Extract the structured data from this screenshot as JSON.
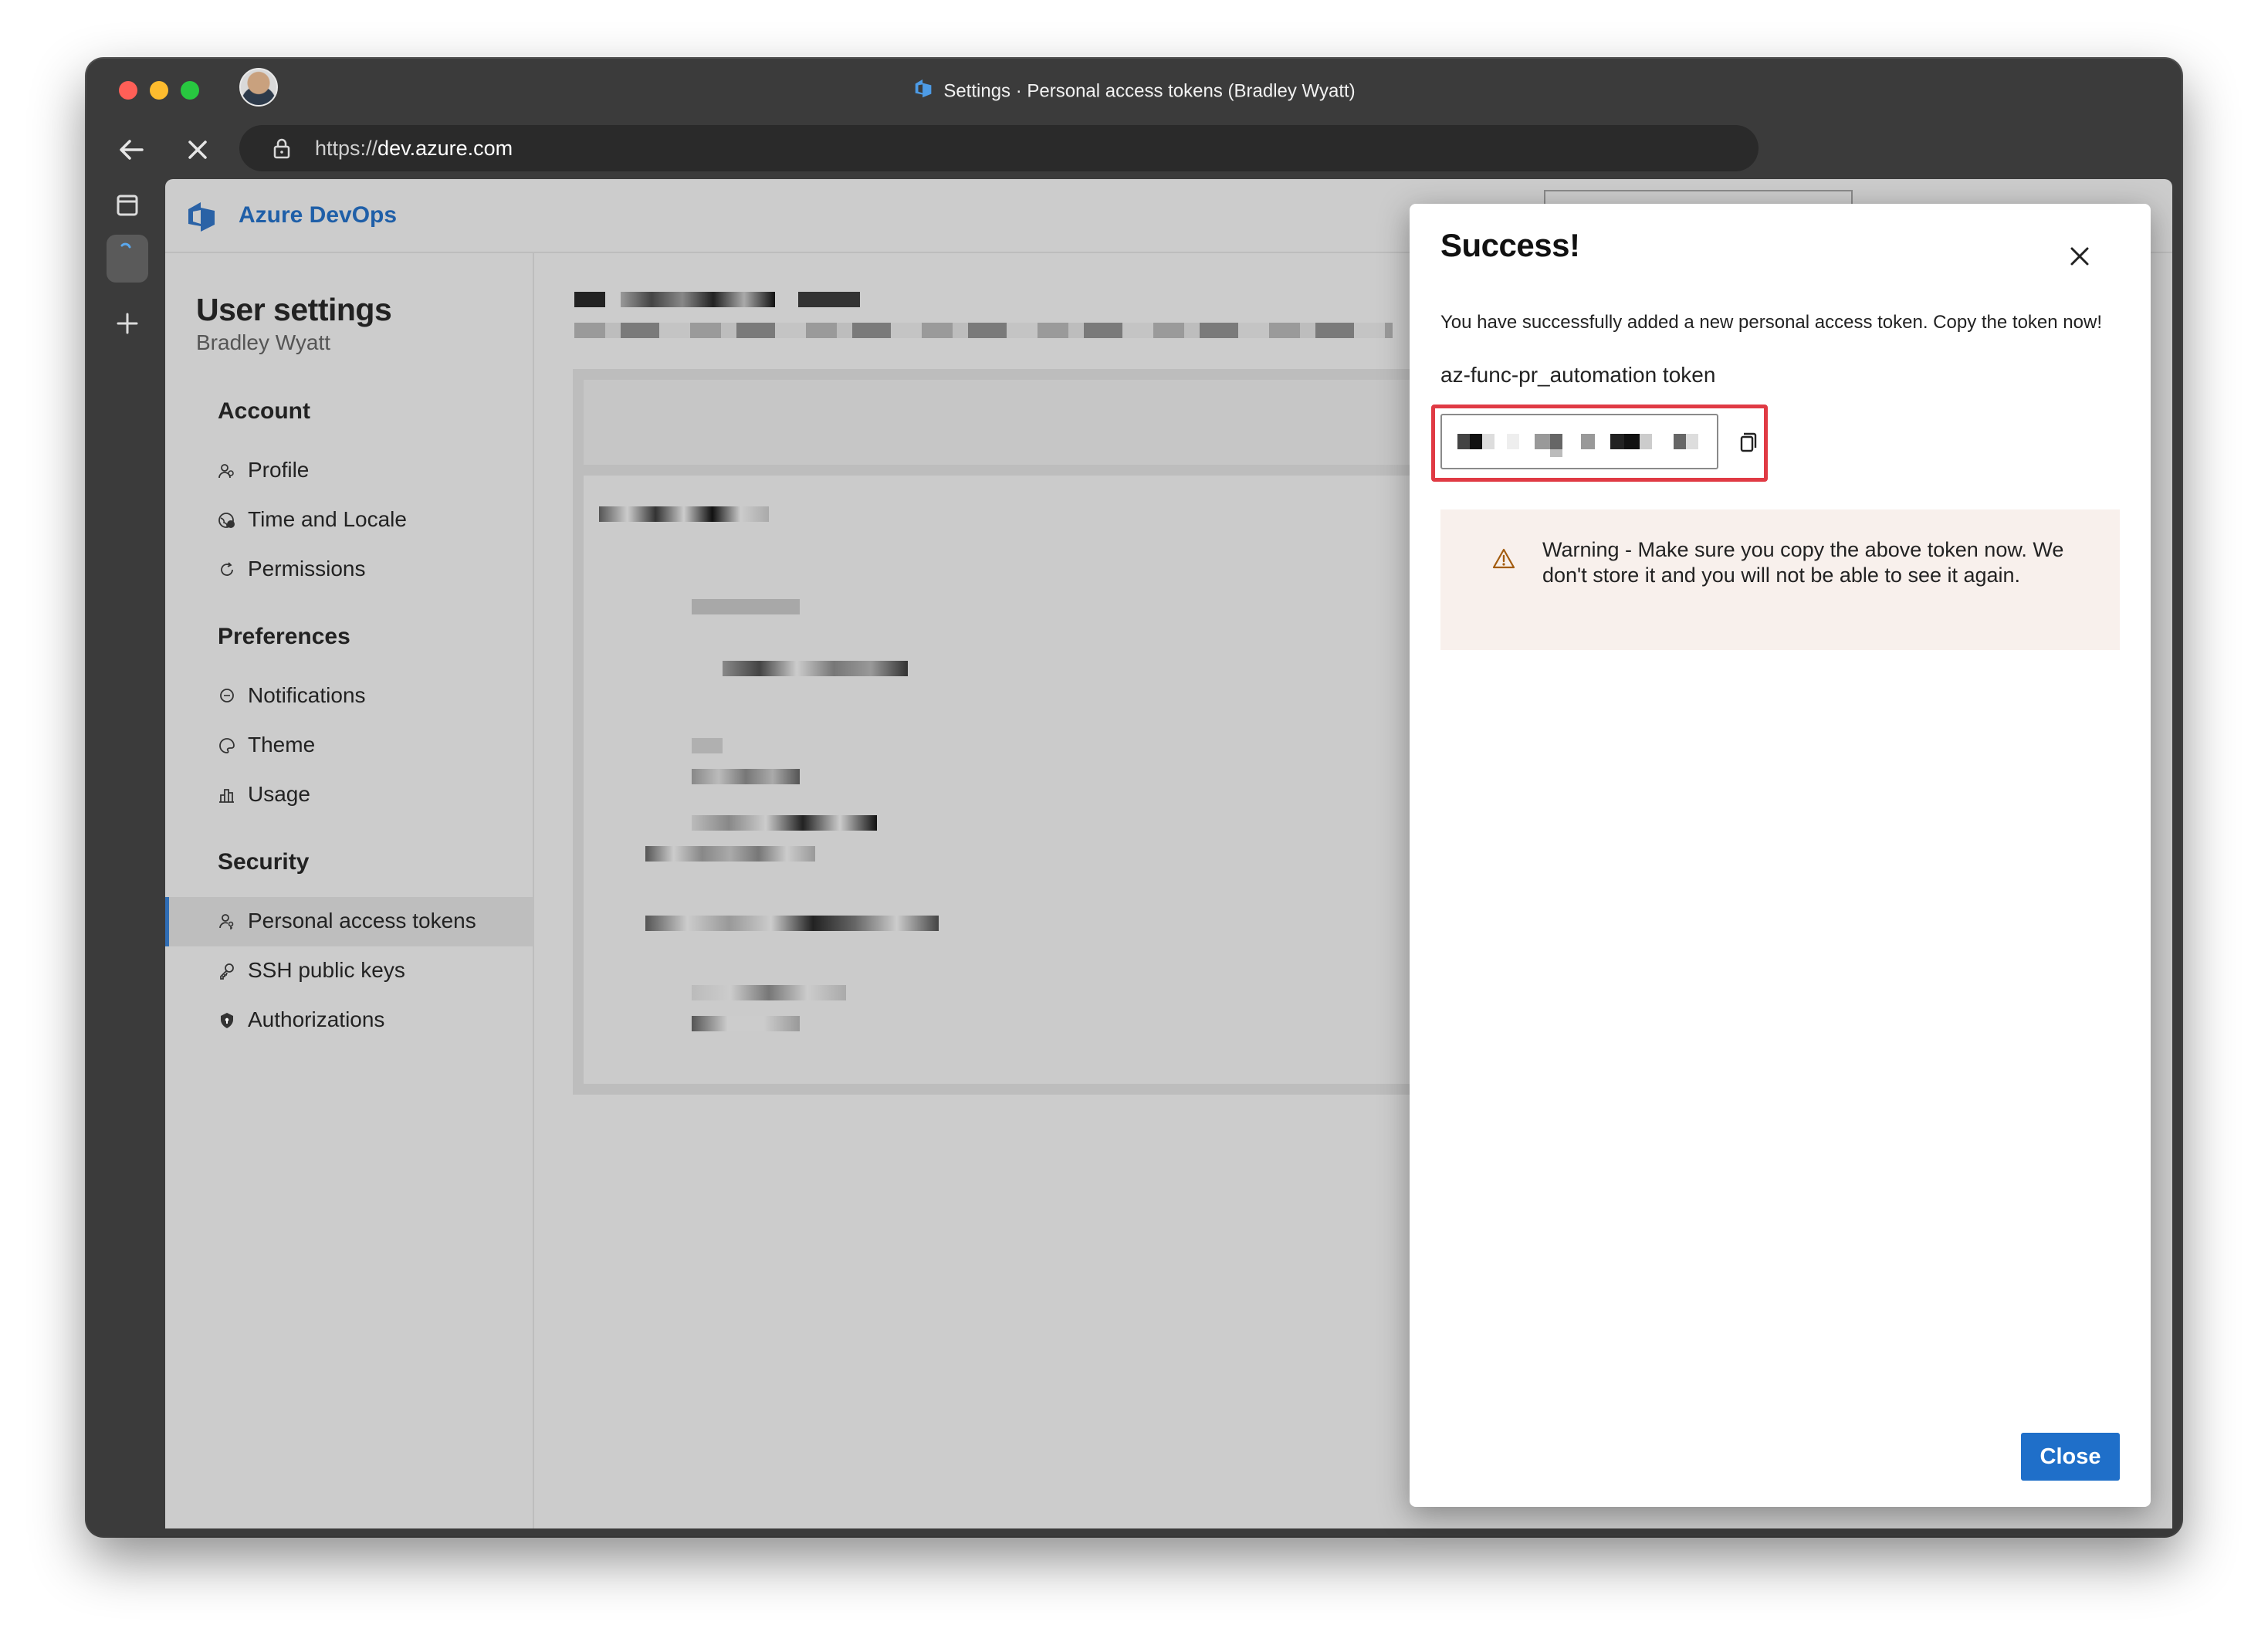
{
  "browser": {
    "window_title": "Settings · Personal access tokens (Bradley Wyatt)",
    "url_scheme": "https://",
    "url_host": "dev.azure.com"
  },
  "app": {
    "name": "Azure DevOps"
  },
  "sidebar": {
    "title": "User settings",
    "user_name": "Bradley Wyatt",
    "sections": [
      {
        "heading": "Account",
        "items": [
          {
            "label": "Profile",
            "icon": "profile-icon"
          },
          {
            "label": "Time and Locale",
            "icon": "globe-icon"
          },
          {
            "label": "Permissions",
            "icon": "refresh-icon"
          }
        ]
      },
      {
        "heading": "Preferences",
        "items": [
          {
            "label": "Notifications",
            "icon": "chat-icon"
          },
          {
            "label": "Theme",
            "icon": "palette-icon"
          },
          {
            "label": "Usage",
            "icon": "chart-icon"
          }
        ]
      },
      {
        "heading": "Security",
        "items": [
          {
            "label": "Personal access tokens",
            "icon": "person-key-icon",
            "active": true
          },
          {
            "label": "SSH public keys",
            "icon": "key-icon"
          },
          {
            "label": "Authorizations",
            "icon": "lock-icon"
          }
        ]
      }
    ]
  },
  "dialog": {
    "title": "Success!",
    "message": "You have successfully added a new personal access token. Copy the token now!",
    "token_name": "az-func-pr_automation token",
    "warning": "Warning - Make sure you copy the above token now. We don't store it and you will not be able to see it again.",
    "close_label": "Close"
  },
  "colors": {
    "accent": "#1f6fc9",
    "highlight_border": "#e03a44",
    "warning_bg": "#f8f0ec",
    "brand": "#1f5fa8"
  }
}
